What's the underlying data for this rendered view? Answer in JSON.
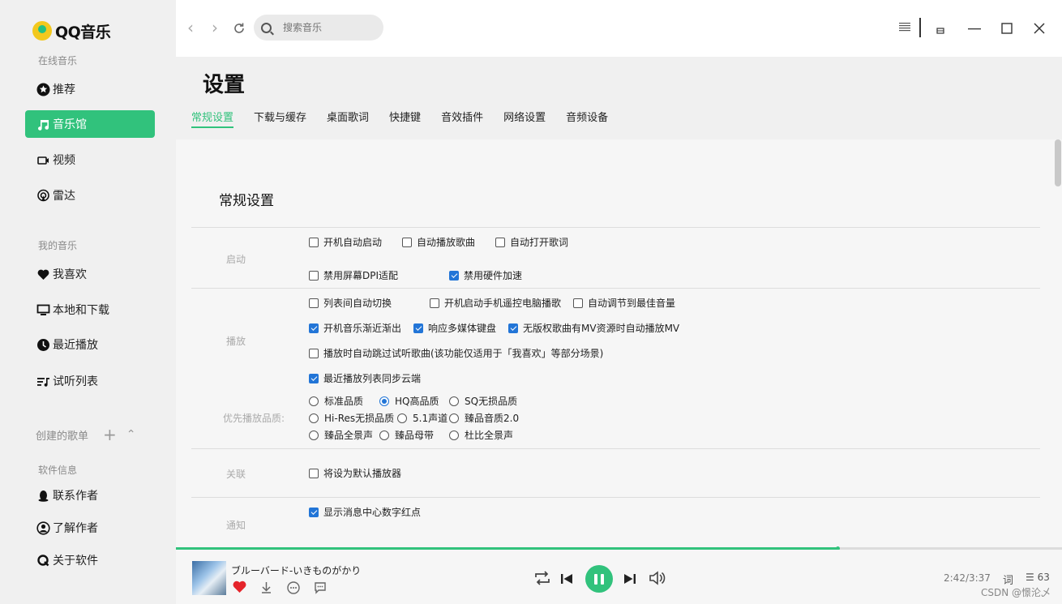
{
  "app": {
    "logo_text": "QQ音乐",
    "accent": "#31c27c",
    "checkbox_color": "#2275d7"
  },
  "sidebar": {
    "group_online": "在线音乐",
    "online_items": [
      {
        "label": "推荐",
        "icon": "star-circle-icon"
      },
      {
        "label": "音乐馆",
        "icon": "music-note-icon",
        "active": true
      },
      {
        "label": "视频",
        "icon": "video-icon"
      },
      {
        "label": "雷达",
        "icon": "radar-icon"
      }
    ],
    "group_mine": "我的音乐",
    "mine_items": [
      {
        "label": "我喜欢",
        "icon": "heart-icon"
      },
      {
        "label": "本地和下载",
        "icon": "monitor-icon"
      },
      {
        "label": "最近播放",
        "icon": "clock-icon"
      },
      {
        "label": "试听列表",
        "icon": "playlist-icon"
      }
    ],
    "group_created": "创建的歌单",
    "group_info": "软件信息",
    "info_items": [
      {
        "label": "联系作者",
        "icon": "qq-penguin-icon"
      },
      {
        "label": "了解作者",
        "icon": "user-circle-icon"
      },
      {
        "label": "关于软件",
        "icon": "q-logo-icon"
      }
    ]
  },
  "topbar": {
    "search_placeholder": "搜索音乐"
  },
  "settings": {
    "title": "设置",
    "tabs": [
      "常规设置",
      "下载与缓存",
      "桌面歌词",
      "快捷键",
      "音效插件",
      "网络设置",
      "音频设备"
    ],
    "section_title": "常规设置",
    "startup": {
      "label": "启动",
      "options": [
        {
          "label": "开机自动启动",
          "checked": false
        },
        {
          "label": "自动播放歌曲",
          "checked": false
        },
        {
          "label": "自动打开歌词",
          "checked": false
        },
        {
          "label": "禁用屏幕DPI适配",
          "checked": false
        },
        {
          "label": "禁用硬件加速",
          "checked": true
        }
      ]
    },
    "playback": {
      "label": "播放",
      "options": [
        {
          "label": "列表间自动切换",
          "checked": false
        },
        {
          "label": "开机启动手机遥控电脑播歌",
          "checked": false
        },
        {
          "label": "自动调节到最佳音量",
          "checked": false
        },
        {
          "label": "开机音乐渐近渐出",
          "checked": true
        },
        {
          "label": "响应多媒体键盘",
          "checked": true
        },
        {
          "label": "无版权歌曲有MV资源时自动播放MV",
          "checked": true
        },
        {
          "label": "播放时自动跳过试听歌曲(该功能仅适用于「我喜欢」等部分场景)",
          "checked": false
        },
        {
          "label": "最近播放列表同步云端",
          "checked": true
        }
      ]
    },
    "quality": {
      "label": "优先播放品质:",
      "options": [
        {
          "label": "标准品质",
          "selected": false
        },
        {
          "label": "HQ高品质",
          "selected": true
        },
        {
          "label": "SQ无损品质",
          "selected": false
        },
        {
          "label": "Hi-Res无损品质",
          "selected": false
        },
        {
          "label": "5.1声道",
          "selected": false
        },
        {
          "label": "臻品音质2.0",
          "selected": false
        },
        {
          "label": "臻品全景声",
          "selected": false
        },
        {
          "label": "臻品母带",
          "selected": false
        },
        {
          "label": "杜比全景声",
          "selected": false
        }
      ]
    },
    "association": {
      "label": "关联",
      "options": [
        {
          "label": "将设为默认播放器",
          "checked": false
        }
      ]
    },
    "notification": {
      "label": "通知",
      "options": [
        {
          "label": "显示消息中心数字红点",
          "checked": true
        }
      ]
    }
  },
  "player": {
    "song": "ブルーバード-いきものがかり",
    "time": "2:42/3:37",
    "progress": 0.747,
    "lyric_label": "词",
    "playlist_count": "63",
    "liked": true
  },
  "watermark": "CSDN @憬沦乄"
}
